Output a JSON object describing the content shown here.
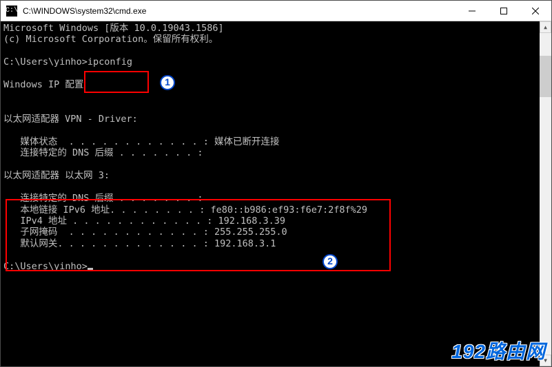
{
  "window": {
    "title": "C:\\WINDOWS\\system32\\cmd.exe"
  },
  "terminal": {
    "line_version": "Microsoft Windows [版本 10.0.19043.1586]",
    "line_copyright": "(c) Microsoft Corporation。保留所有权利。",
    "prompt1_path": "C:\\Users\\yinho>",
    "prompt1_cmd": "ipconfig",
    "header_ipconfig": "Windows IP 配置",
    "adapter1_title": "以太网适配器 VPN - Driver:",
    "adapter1_media_label": "   媒体状态  . . . . . . . . . . . . : ",
    "adapter1_media_value": "媒体已断开连接",
    "adapter1_dns_label": "   连接特定的 DNS 后缀 . . . . . . . :",
    "adapter2_title": "以太网适配器 以太网 3:",
    "adapter2_dns_label": "   连接特定的 DNS 后缀 . . . . . . . :",
    "adapter2_ipv6_label": "   本地链接 IPv6 地址. . . . . . . . : ",
    "adapter2_ipv6_value": "fe80::b986:ef93:f6e7:2f8f%29",
    "adapter2_ipv4_label": "   IPv4 地址 . . . . . . . . . . . . : ",
    "adapter2_ipv4_value": "192.168.3.39",
    "adapter2_mask_label": "   子网掩码  . . . . . . . . . . . . : ",
    "adapter2_mask_value": "255.255.255.0",
    "adapter2_gw_label": "   默认网关. . . . . . . . . . . . . : ",
    "adapter2_gw_value": "192.168.3.1",
    "prompt2_path": "C:\\Users\\yinho>"
  },
  "annotations": {
    "badge1": "1",
    "badge2": "2"
  },
  "watermark": "192路由网"
}
